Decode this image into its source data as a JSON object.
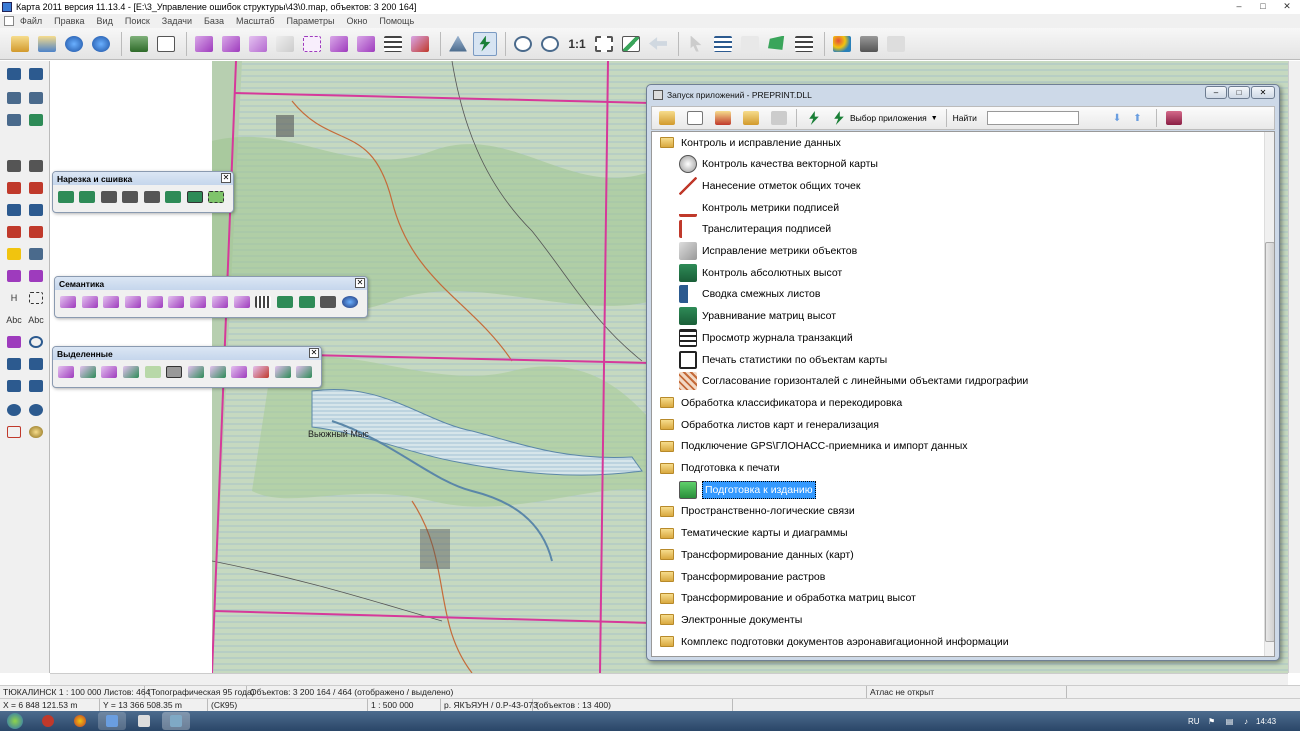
{
  "window": {
    "title": "Карта 2011 версия 11.13.4 - [E:\\3_Управление ошибок структуры\\43\\0.map, объектов: 3 200 164]",
    "controls": [
      "–",
      "□",
      "✕"
    ]
  },
  "menu": [
    "Файл",
    "Правка",
    "Вид",
    "Поиск",
    "Задачи",
    "База",
    "Масштаб",
    "Параметры",
    "Окно",
    "Помощь"
  ],
  "toolbar": {
    "scale_label": "1:1"
  },
  "left_toolbar": {
    "label_h": "H",
    "label_abc1": "Abc",
    "label_abc2": "Abc"
  },
  "panels": {
    "cut": {
      "title": "Нарезка и сшивка",
      "close": "✕"
    },
    "semantics": {
      "title": "Семантика",
      "close": "✕"
    },
    "selected": {
      "title": "Выделенные",
      "close": "✕"
    }
  },
  "map": {
    "place_label": "Вьюжный Мыс"
  },
  "app_window": {
    "title": "Запуск приложений - PREPRINT.DLL",
    "select_app_label": "Выбор приложения",
    "find_label": "Найти",
    "find_value": "",
    "tree": [
      {
        "type": "folder-open",
        "label": "Контроль и исправление данных"
      },
      {
        "type": "item",
        "label": "Контроль качества векторной карты"
      },
      {
        "type": "item",
        "label": "Нанесение отметок общих точек"
      },
      {
        "type": "item",
        "label": "Контроль метрики подписей"
      },
      {
        "type": "item",
        "label": "Транслитерация подписей"
      },
      {
        "type": "item",
        "label": "Исправление метрики объектов"
      },
      {
        "type": "item",
        "label": "Контроль абсолютных высот"
      },
      {
        "type": "item",
        "label": "Сводка смежных листов"
      },
      {
        "type": "item",
        "label": "Уравнивание матриц высот"
      },
      {
        "type": "item",
        "label": "Просмотр журнала транзакций"
      },
      {
        "type": "item",
        "label": "Печать статистики по объектам карты"
      },
      {
        "type": "item",
        "label": "Согласование горизонталей с линейными объектами гидрографии"
      },
      {
        "type": "folder",
        "label": "Обработка классификатора и перекодировка"
      },
      {
        "type": "folder",
        "label": "Обработка листов карт и генерализация"
      },
      {
        "type": "folder",
        "label": "Подключение GPS\\ГЛОНАСС-приемника и импорт данных"
      },
      {
        "type": "folder-open",
        "label": "Подготовка к печати"
      },
      {
        "type": "item-selected",
        "label": "Подготовка к изданию"
      },
      {
        "type": "folder",
        "label": "Пространственно-логические связи"
      },
      {
        "type": "folder",
        "label": "Тематические карты и диаграммы"
      },
      {
        "type": "folder",
        "label": "Трансформирование данных (карт)"
      },
      {
        "type": "folder",
        "label": "Трансформирование растров"
      },
      {
        "type": "folder",
        "label": "Трансформирование и обработка матриц высот"
      },
      {
        "type": "folder",
        "label": "Электронные документы"
      },
      {
        "type": "folder",
        "label": "Комплекс подготовки документов аэронавигационной информации"
      }
    ]
  },
  "status": {
    "map_name": "ТЮКАЛИНСК  1 : 100 000  Листов: 464",
    "map_type": "(Топографическая 95 года)",
    "objects": "Объектов: 3 200 164 / 464 (отображено / выделено)",
    "atlas": "Атлас не открыт",
    "coord_x": "X = 6 848 121.53 m",
    "coord_y": "Y = 13 366 508.35 m",
    "cs": "(СК95)",
    "scale": "1 : 500 000",
    "sheet": "р. ЯКЪЯУН / 0.Р-43-073",
    "sheet_objects": "(объектов : 13 400)"
  },
  "taskbar": {
    "lang": "RU",
    "clock": "14:43"
  },
  "colors": {
    "accent": "#3399ff",
    "map_grid": "#d6399a",
    "map_bg": "#b7cfb0",
    "water": "#cfe0ea"
  }
}
